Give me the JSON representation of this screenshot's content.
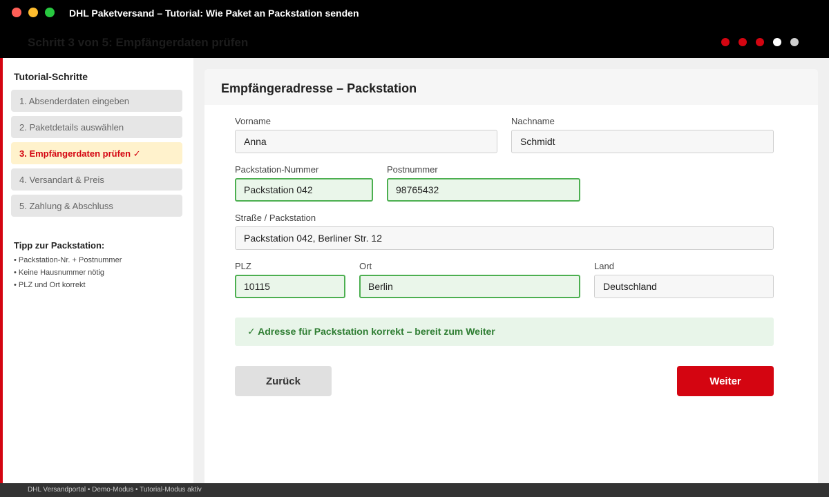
{
  "window": {
    "title": "DHL Paketversand – Tutorial: Wie Paket an Packstation senden"
  },
  "header": {
    "step_title": "Schritt 3 von 5: Empfängerdaten prüfen",
    "progress": {
      "current": 3,
      "completed": 3,
      "total": 5
    }
  },
  "sidebar": {
    "heading": "Tutorial-Schritte",
    "steps": [
      {
        "label": "1. Absenderdaten eingeben"
      },
      {
        "label": "2. Paketdetails auswählen"
      },
      {
        "label": "3. Empfängerdaten prüfen ✓"
      },
      {
        "label": "4. Versandart & Preis"
      },
      {
        "label": "5. Zahlung & Abschluss"
      }
    ],
    "tip": {
      "heading": "Tipp zur Packstation:",
      "lines": [
        "• Packstation-Nr. + Postnummer",
        "• Keine Hausnummer nötig",
        "• PLZ und Ort korrekt"
      ]
    }
  },
  "form": {
    "title": "Empfängeradresse – Packstation",
    "vorname": {
      "label": "Vorname",
      "value": "Anna"
    },
    "nachname": {
      "label": "Nachname",
      "value": "Schmidt"
    },
    "packstation": {
      "label": "Packstation-Nummer",
      "value": "Packstation 042"
    },
    "postnummer": {
      "label": "Postnummer",
      "value": "98765432"
    },
    "strasse": {
      "label": "Straße / Packstation",
      "value": "Packstation 042, Berliner Str. 12"
    },
    "plz": {
      "label": "PLZ",
      "value": "10115"
    },
    "ort": {
      "label": "Ort",
      "value": "Berlin"
    },
    "land": {
      "label": "Land",
      "value": "Deutschland"
    },
    "success_message": "✓ Adresse für Packstation korrekt – bereit zum Weiter",
    "back_label": "Zurück",
    "next_label": "Weiter"
  },
  "footer": {
    "text": "DHL Versandportal • Demo-Modus • Tutorial-Modus aktiv"
  },
  "colors": {
    "brand_red": "#d40511",
    "success_green": "#4caf50",
    "active_step_bg": "#fff2cc"
  }
}
